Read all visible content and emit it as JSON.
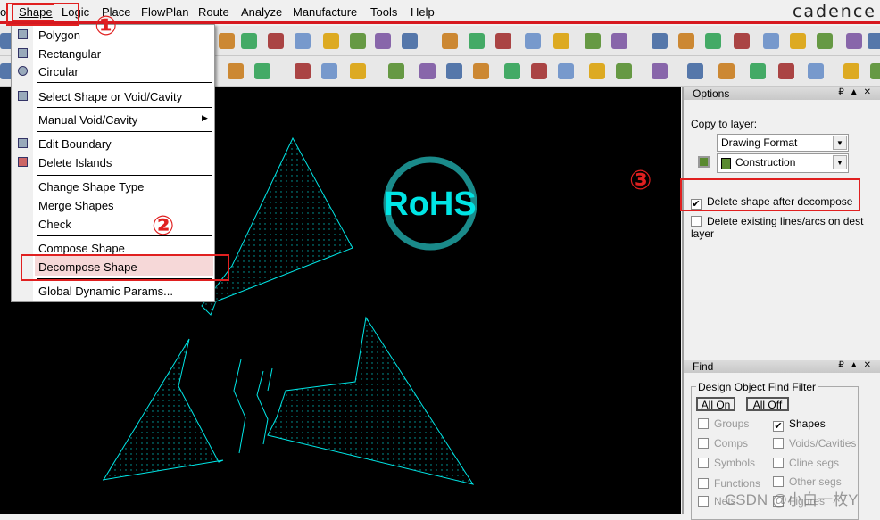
{
  "menubar": {
    "items": [
      "o",
      "Shape",
      "Logic",
      "Place",
      "FlowPlan",
      "Route",
      "Analyze",
      "Manufacture",
      "Tools",
      "Help"
    ],
    "brand": "cadence"
  },
  "shape_menu": {
    "items": [
      "Polygon",
      "Rectangular",
      "Circular",
      "Select Shape or Void/Cavity",
      "Manual Void/Cavity",
      "Edit Boundary",
      "Delete Islands",
      "Change Shape Type",
      "Merge Shapes",
      "Check",
      "Compose Shape",
      "Decompose Shape",
      "Global Dynamic Params..."
    ],
    "highlighted": "Decompose Shape"
  },
  "canvas": {
    "logo_text": "RoHS",
    "colors": {
      "background": "#000000",
      "shapes": "#00e5e5"
    }
  },
  "options": {
    "title": "Options",
    "copy_label": "Copy to layer:",
    "class_value": "Drawing Format",
    "subclass_value": "Construction",
    "subclass_color": "#5a8a30",
    "delete_shape": {
      "label": "Delete shape after decompose",
      "checked": true
    },
    "delete_existing": {
      "label": "Delete existing lines/arcs on dest layer",
      "checked": false
    }
  },
  "find": {
    "title": "Find",
    "group_title": "Design Object Find Filter",
    "all_on": "All On",
    "all_off": "All Off",
    "items": [
      {
        "label": "Groups",
        "checked": false
      },
      {
        "label": "Shapes",
        "checked": true
      },
      {
        "label": "Comps",
        "checked": false
      },
      {
        "label": "Voids/Cavities",
        "checked": false
      },
      {
        "label": "Symbols",
        "checked": false
      },
      {
        "label": "Cline segs",
        "checked": false
      },
      {
        "label": "Functions",
        "checked": false
      },
      {
        "label": "Other segs",
        "checked": false
      },
      {
        "label": "Nets",
        "checked": false
      },
      {
        "label": "Figures",
        "checked": false
      }
    ]
  },
  "annotations": [
    "①",
    "②",
    "③"
  ],
  "watermark": "CSDN @小白一枚Y"
}
